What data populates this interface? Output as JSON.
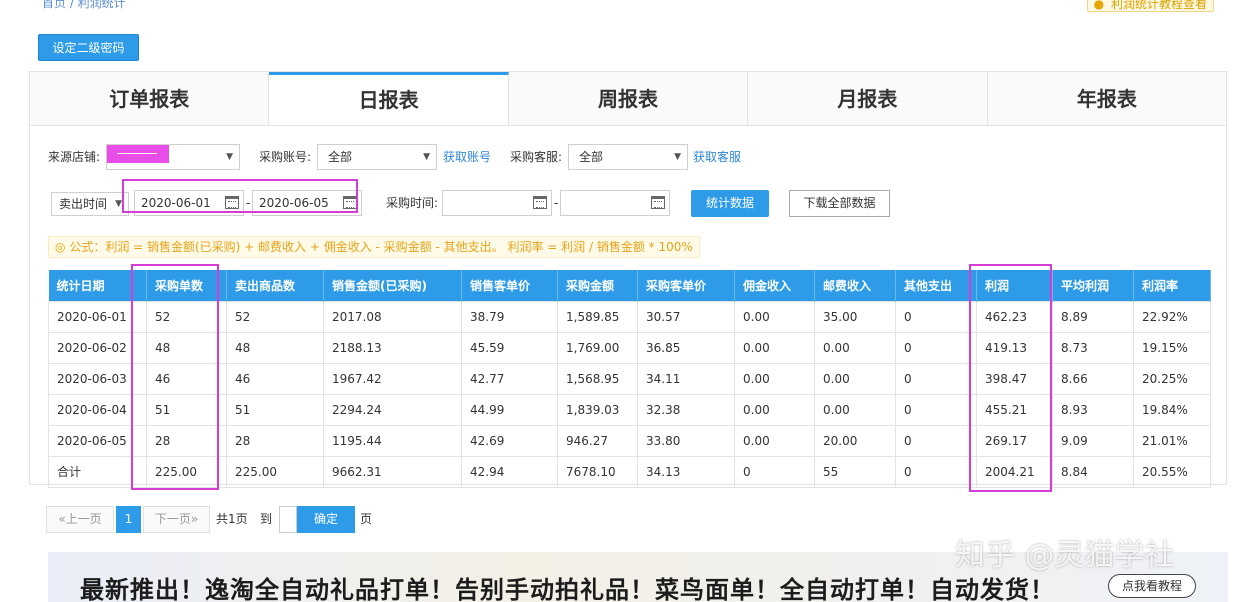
{
  "breadcrumb": "首页 / 利润统计",
  "help_link": "利润统计教程查看",
  "set_password_button": "设定二级密码",
  "tabs": [
    "订单报表",
    "日报表",
    "周报表",
    "月报表",
    "年报表"
  ],
  "active_tab": "日报表",
  "filters": {
    "source_store_label": "来源店铺:",
    "purchase_account_label": "采购账号:",
    "purchase_account_value": "全部",
    "get_account_link": "获取账号",
    "purchase_service_label": "采购客服:",
    "purchase_service_value": "全部",
    "get_service_link": "获取客服",
    "sell_time_select": "卖出时间",
    "date_from": "2020-06-01",
    "date_to": "2020-06-05",
    "dash": "-",
    "purchase_time_label": "采购时间:",
    "stat_button": "统计数据",
    "download_button": "下载全部数据"
  },
  "formula": "公式：利润 = 销售金额(已采购) + 邮费收入 + 佣金收入 - 采购金额 - 其他支出。  利润率 = 利润 / 销售金额 * 100%",
  "table": {
    "headers": [
      "统计日期",
      "采购单数",
      "卖出商品数",
      "销售金额(已采购)",
      "销售客单价",
      "采购金额",
      "采购客单价",
      "佣金收入",
      "邮费收入",
      "其他支出",
      "利润",
      "平均利润",
      "利润率"
    ],
    "rows": [
      [
        "2020-06-01",
        "52",
        "52",
        "2017.08",
        "38.79",
        "1,589.85",
        "30.57",
        "0.00",
        "35.00",
        "0",
        "462.23",
        "8.89",
        "22.92%"
      ],
      [
        "2020-06-02",
        "48",
        "48",
        "2188.13",
        "45.59",
        "1,769.00",
        "36.85",
        "0.00",
        "0.00",
        "0",
        "419.13",
        "8.73",
        "19.15%"
      ],
      [
        "2020-06-03",
        "46",
        "46",
        "1967.42",
        "42.77",
        "1,568.95",
        "34.11",
        "0.00",
        "0.00",
        "0",
        "398.47",
        "8.66",
        "20.25%"
      ],
      [
        "2020-06-04",
        "51",
        "51",
        "2294.24",
        "44.99",
        "1,839.03",
        "32.38",
        "0.00",
        "0.00",
        "0",
        "455.21",
        "8.93",
        "19.84%"
      ],
      [
        "2020-06-05",
        "28",
        "28",
        "1195.44",
        "42.69",
        "946.27",
        "33.80",
        "0.00",
        "20.00",
        "0",
        "269.17",
        "9.09",
        "21.01%"
      ],
      [
        "合计",
        "225.00",
        "225.00",
        "9662.31",
        "42.94",
        "7678.10",
        "34.13",
        "0",
        "55",
        "0",
        "2004.21",
        "8.84",
        "20.55%"
      ]
    ]
  },
  "pager": {
    "prev": "«上一页",
    "current": "1",
    "next": "下一页»",
    "total": "共1页",
    "goto": "到",
    "confirm": "确定",
    "page_unit": "页"
  },
  "banner": {
    "text": "最新推出！逸淘全自动礼品打单！告别手动拍礼品！菜鸟面单！全自动打单！自动发货！",
    "button": "点我看教程"
  },
  "watermark": "知乎 @灵猫学社",
  "colors": {
    "primary": "#2e9be8",
    "highlight": "#d63dd6",
    "formula_text": "#e5a319"
  }
}
